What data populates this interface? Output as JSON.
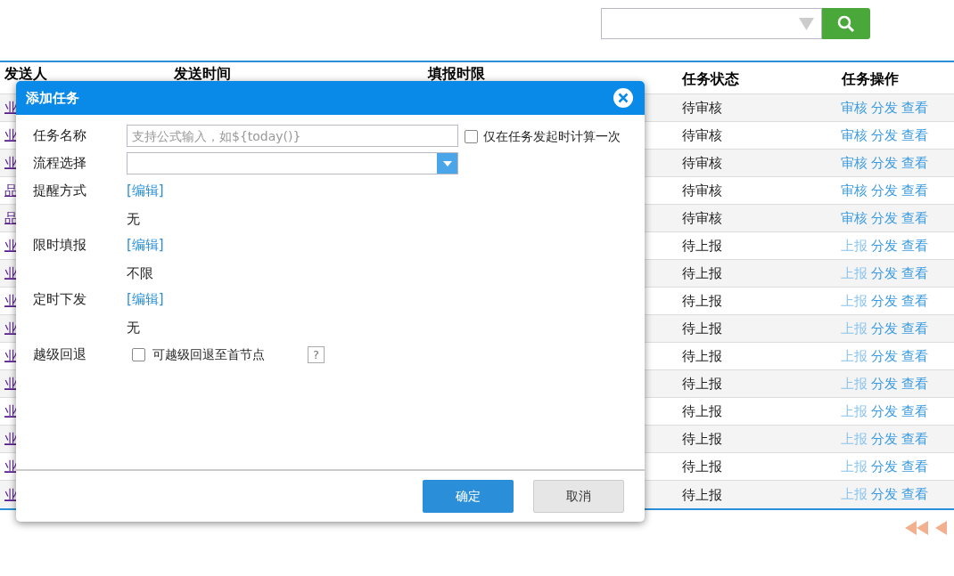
{
  "table": {
    "columns": [
      "发送人",
      "发送时间",
      "填报时限",
      "任务状态",
      "任务操作"
    ],
    "rows": [
      {
        "sender": "业",
        "status": "待审核",
        "actions": [
          {
            "label": "审核",
            "disabled": false
          },
          {
            "label": "分发",
            "disabled": false
          },
          {
            "label": "查看",
            "disabled": false
          }
        ]
      },
      {
        "sender": "业",
        "status": "待审核",
        "actions": [
          {
            "label": "审核",
            "disabled": false
          },
          {
            "label": "分发",
            "disabled": false
          },
          {
            "label": "查看",
            "disabled": false
          }
        ]
      },
      {
        "sender": "业",
        "status": "待审核",
        "actions": [
          {
            "label": "审核",
            "disabled": false
          },
          {
            "label": "分发",
            "disabled": false
          },
          {
            "label": "查看",
            "disabled": false
          }
        ]
      },
      {
        "sender": "品",
        "status": "待审核",
        "actions": [
          {
            "label": "审核",
            "disabled": false
          },
          {
            "label": "分发",
            "disabled": false
          },
          {
            "label": "查看",
            "disabled": false
          }
        ]
      },
      {
        "sender": "品",
        "status": "待审核",
        "actions": [
          {
            "label": "审核",
            "disabled": false
          },
          {
            "label": "分发",
            "disabled": false
          },
          {
            "label": "查看",
            "disabled": false
          }
        ]
      },
      {
        "sender": "业",
        "status": "待上报",
        "actions": [
          {
            "label": "上报",
            "disabled": true
          },
          {
            "label": "分发",
            "disabled": false
          },
          {
            "label": "查看",
            "disabled": false
          }
        ]
      },
      {
        "sender": "业",
        "status": "待上报",
        "actions": [
          {
            "label": "上报",
            "disabled": true
          },
          {
            "label": "分发",
            "disabled": false
          },
          {
            "label": "查看",
            "disabled": false
          }
        ]
      },
      {
        "sender": "业",
        "status": "待上报",
        "actions": [
          {
            "label": "上报",
            "disabled": true
          },
          {
            "label": "分发",
            "disabled": false
          },
          {
            "label": "查看",
            "disabled": false
          }
        ]
      },
      {
        "sender": "业",
        "status": "待上报",
        "actions": [
          {
            "label": "上报",
            "disabled": true
          },
          {
            "label": "分发",
            "disabled": false
          },
          {
            "label": "查看",
            "disabled": false
          }
        ]
      },
      {
        "sender": "业",
        "status": "待上报",
        "actions": [
          {
            "label": "上报",
            "disabled": true
          },
          {
            "label": "分发",
            "disabled": false
          },
          {
            "label": "查看",
            "disabled": false
          }
        ]
      },
      {
        "sender": "业",
        "status": "待上报",
        "actions": [
          {
            "label": "上报",
            "disabled": true
          },
          {
            "label": "分发",
            "disabled": false
          },
          {
            "label": "查看",
            "disabled": false
          }
        ]
      },
      {
        "sender": "业",
        "status": "待上报",
        "actions": [
          {
            "label": "上报",
            "disabled": true
          },
          {
            "label": "分发",
            "disabled": false
          },
          {
            "label": "查看",
            "disabled": false
          }
        ]
      },
      {
        "sender": "业",
        "status": "待上报",
        "actions": [
          {
            "label": "上报",
            "disabled": true
          },
          {
            "label": "分发",
            "disabled": false
          },
          {
            "label": "查看",
            "disabled": false
          }
        ]
      },
      {
        "sender": "业",
        "status": "待上报",
        "actions": [
          {
            "label": "上报",
            "disabled": true
          },
          {
            "label": "分发",
            "disabled": false
          },
          {
            "label": "查看",
            "disabled": false
          }
        ]
      },
      {
        "sender": "业",
        "status": "待上报",
        "actions": [
          {
            "label": "上报",
            "disabled": true
          },
          {
            "label": "分发",
            "disabled": false
          },
          {
            "label": "查看",
            "disabled": false
          }
        ]
      }
    ]
  },
  "dialog": {
    "title": "添加任务",
    "fields": [
      {
        "kind": "text",
        "label": "任务名称",
        "placeholder": "支持公式输入，如${today()}",
        "option": {
          "label": "仅在任务发起时计算一次",
          "checked": false
        }
      },
      {
        "kind": "select",
        "label": "流程选择"
      },
      {
        "kind": "edit",
        "label": "提醒方式",
        "link": "[编辑]",
        "value": "无"
      },
      {
        "kind": "edit",
        "label": "限时填报",
        "link": "[编辑]",
        "value": "不限"
      },
      {
        "kind": "edit",
        "label": "定时下发",
        "link": "[编辑]",
        "value": "无"
      },
      {
        "kind": "checkbox",
        "label": "越级回退",
        "option": {
          "label": "可越级回退至首节点",
          "checked": false
        },
        "help": "?"
      }
    ],
    "buttons": [
      {
        "label": "确定",
        "kind": "primary"
      },
      {
        "label": "取消",
        "kind": "secondary"
      }
    ]
  }
}
